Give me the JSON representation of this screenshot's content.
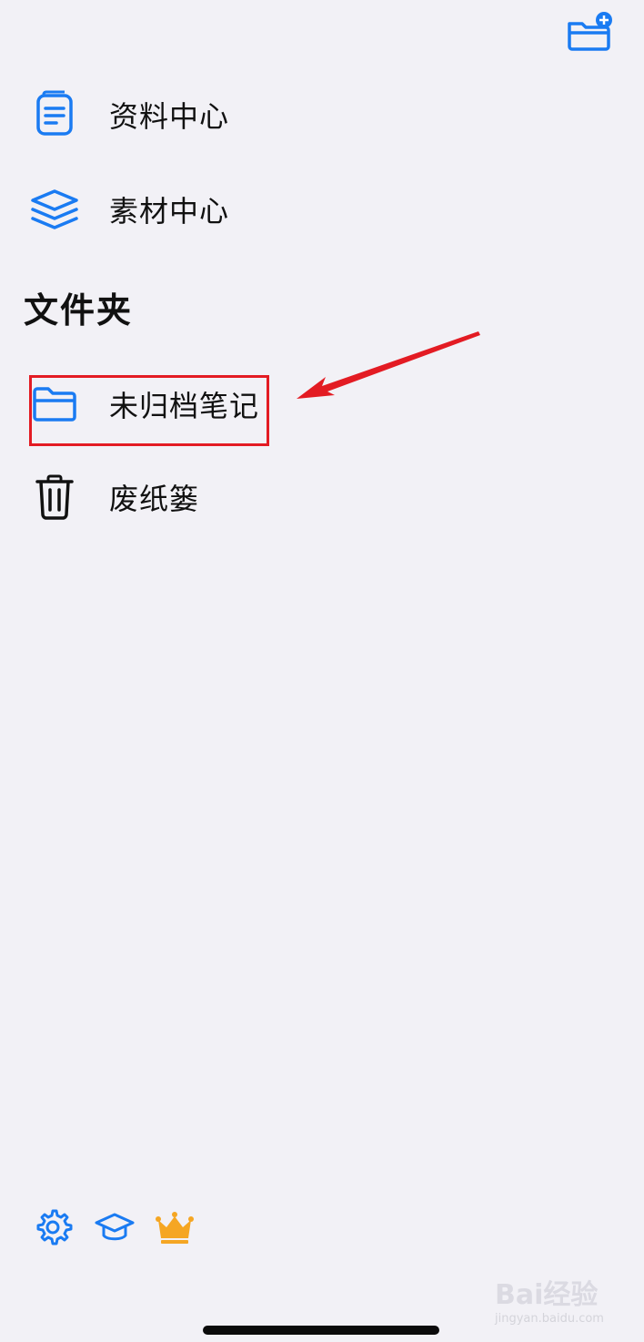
{
  "header": {
    "add_folder_icon": "folder-plus-icon"
  },
  "top_items": [
    {
      "label": "资料中心",
      "icon": "document-icon"
    },
    {
      "label": "素材中心",
      "icon": "layers-icon"
    }
  ],
  "folders": {
    "title": "文件夹",
    "items": [
      {
        "label": "未归档笔记",
        "icon": "folder-icon"
      },
      {
        "label": "废纸篓",
        "icon": "trash-icon"
      }
    ]
  },
  "bottom_bar": {
    "icons": [
      "gear-icon",
      "graduation-cap-icon",
      "crown-icon"
    ]
  },
  "watermark": {
    "brand": "Bai经验",
    "url": "jingyan.baidu.com"
  },
  "colors": {
    "accent": "#1a7bf2",
    "highlight": "#e31b23",
    "crown": "#f5a623",
    "background": "#f2f1f6"
  }
}
